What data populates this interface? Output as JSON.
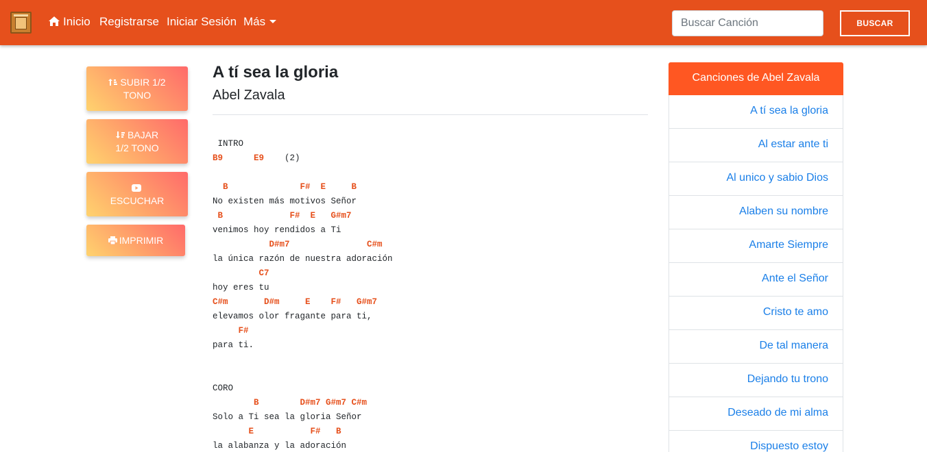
{
  "navbar": {
    "home": "Inicio",
    "register": "Registrarse",
    "login": "Iniciar Sesión",
    "more": "Más",
    "search_placeholder": "Buscar Canción",
    "search_button": "BUSCAR"
  },
  "actions": {
    "raise_line1": "SUBIR 1/2",
    "raise_line2": "TONO",
    "lower_line1": "BAJAR",
    "lower_line2": "1/2 TONO",
    "listen": "ESCUCHAR",
    "print": "IMPRIMIR"
  },
  "song": {
    "title": "A tí sea la gloria",
    "artist": "Abel Zavala",
    "lines": [
      {
        "type": "lyric",
        "text": " INTRO"
      },
      {
        "type": "chord",
        "text": "B9      E9",
        "after": "    (2)"
      },
      {
        "type": "lyric",
        "text": " "
      },
      {
        "type": "chord",
        "text": "  B              F#  E     B"
      },
      {
        "type": "lyric",
        "text": "No existen más motivos Señor"
      },
      {
        "type": "chord",
        "text": " B             F#  E   G#m7"
      },
      {
        "type": "lyric",
        "text": "venimos hoy rendidos a Ti"
      },
      {
        "type": "chord",
        "text": "           D#m7               C#m"
      },
      {
        "type": "lyric",
        "text": "la única razón de nuestra adoración"
      },
      {
        "type": "chord",
        "text": "         C7"
      },
      {
        "type": "lyric",
        "text": "hoy eres tu"
      },
      {
        "type": "chord",
        "text": "C#m       D#m     E    F#   G#m7"
      },
      {
        "type": "lyric",
        "text": "elevamos olor fragante para ti,"
      },
      {
        "type": "chord",
        "text": "     F#"
      },
      {
        "type": "lyric",
        "text": "para ti."
      },
      {
        "type": "lyric",
        "text": " "
      },
      {
        "type": "lyric",
        "text": " "
      },
      {
        "type": "lyric",
        "text": "CORO"
      },
      {
        "type": "chord",
        "text": "        B        D#m7 G#m7 C#m"
      },
      {
        "type": "lyric",
        "text": "Solo a Ti sea la gloria Señor"
      },
      {
        "type": "chord",
        "text": "       E           F#   B"
      },
      {
        "type": "lyric",
        "text": "la alabanza y la adoración"
      }
    ]
  },
  "sidebar": {
    "header": "Canciones de Abel Zavala",
    "songs": [
      "A tí sea la gloria",
      "Al estar ante ti",
      "Al unico y sabio Dios",
      "Alaben su nombre",
      "Amarte Siempre",
      "Ante el Señor",
      "Cristo te amo",
      "De tal manera",
      "Dejando tu trono",
      "Deseado de mi alma",
      "Dispuesto estoy"
    ]
  }
}
